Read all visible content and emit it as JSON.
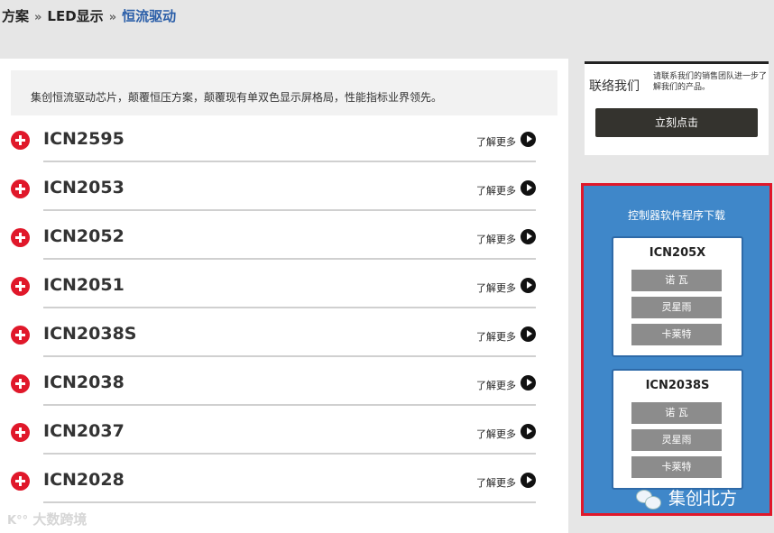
{
  "breadcrumb": {
    "items": [
      "方案",
      "LED显示"
    ],
    "current": "恒流驱动",
    "separator": "»"
  },
  "description": "集创恒流驱动芯片，颠覆恒压方案，颠覆现有单双色显示屏格局，性能指标业界领先。",
  "products": [
    {
      "name": "ICN2595",
      "more": "了解更多"
    },
    {
      "name": "ICN2053",
      "more": "了解更多"
    },
    {
      "name": "ICN2052",
      "more": "了解更多"
    },
    {
      "name": "ICN2051",
      "more": "了解更多"
    },
    {
      "name": "ICN2038S",
      "more": "了解更多"
    },
    {
      "name": "ICN2038",
      "more": "了解更多"
    },
    {
      "name": "ICN2037",
      "more": "了解更多"
    },
    {
      "name": "ICN2028",
      "more": "了解更多"
    }
  ],
  "contact": {
    "title": "联络我们",
    "text": "请联系我们的销售团队进一步了解我们的产品。",
    "button": "立刻点击"
  },
  "download": {
    "title": "控制器软件程序下载",
    "cards": [
      {
        "title": "ICN205X",
        "buttons": [
          "诺 瓦",
          "灵星雨",
          "卡莱特"
        ]
      },
      {
        "title": "ICN2038S",
        "buttons": [
          "诺 瓦",
          "灵星雨",
          "卡莱特"
        ]
      }
    ]
  },
  "watermarks": {
    "wechat": "集创北方",
    "corner": "大数跨境"
  },
  "colors": {
    "accent_red": "#e0182a",
    "panel_blue": "#3f87c9",
    "breadcrumb_current": "#2a5ea8"
  }
}
